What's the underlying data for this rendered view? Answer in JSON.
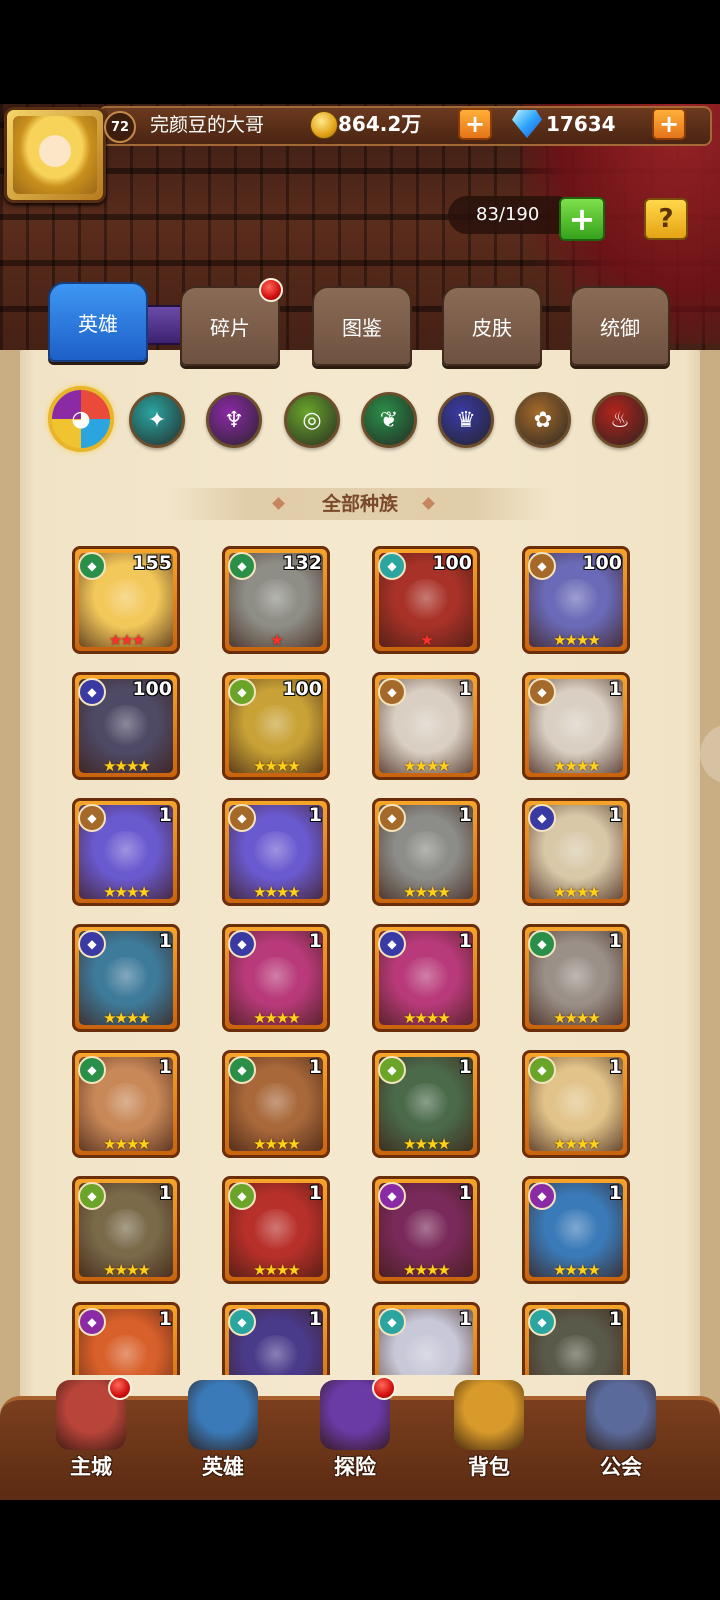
{
  "player": {
    "level": "72",
    "name": "完颜豆的大哥",
    "coins": "864.2万",
    "gems": "17634",
    "add_label": "+"
  },
  "capacity": {
    "text": "83/190",
    "add_label": "+",
    "help_label": "?"
  },
  "tabs": [
    {
      "label": "英雄",
      "active": true
    },
    {
      "label": "碎片",
      "active": false,
      "notification": true
    },
    {
      "label": "图鉴",
      "active": false
    },
    {
      "label": "皮肤",
      "active": false
    },
    {
      "label": "统御",
      "active": false
    }
  ],
  "races": [
    {
      "icon": "all-races-icon",
      "color": "#e94a3a",
      "selected": true
    },
    {
      "icon": "race-water-icon",
      "color": "#2aa5a0"
    },
    {
      "icon": "race-mystic-icon",
      "color": "#8a2aa5"
    },
    {
      "icon": "race-forest-icon",
      "color": "#6aa52a"
    },
    {
      "icon": "race-nature-icon",
      "color": "#2a8f48"
    },
    {
      "icon": "race-shadow-icon",
      "color": "#3a3aa5"
    },
    {
      "icon": "race-light-icon",
      "color": "#a56a2a"
    },
    {
      "icon": "race-fire-icon",
      "color": "#b2241c"
    }
  ],
  "race_filter_title": "全部种族",
  "heroes": [
    {
      "level": "155",
      "race_color": "#2a8f48",
      "stars": "★★★",
      "star_color": "#ff3030",
      "art": "#f3c85a"
    },
    {
      "level": "132",
      "race_color": "#2a8f48",
      "stars": "★",
      "star_color": "#ff3030",
      "art": "#8e8e86"
    },
    {
      "level": "100",
      "race_color": "#2aa5a0",
      "stars": "★",
      "star_color": "#ff3030",
      "art": "#a83228"
    },
    {
      "level": "100",
      "race_color": "#a56a2a",
      "stars": "★★★★",
      "star_color": "#ffd21a",
      "art": "#6a6ab8"
    },
    {
      "level": "100",
      "race_color": "#3a3aa5",
      "stars": "★★★★",
      "star_color": "#ffd21a",
      "art": "#4e4a66"
    },
    {
      "level": "100",
      "race_color": "#6aa52a",
      "stars": "★★★★",
      "star_color": "#ffd21a",
      "art": "#c8a236"
    },
    {
      "level": "1",
      "race_color": "#a56a2a",
      "stars": "★★★★",
      "star_color": "#ffd21a",
      "art": "#d9cfc2"
    },
    {
      "level": "1",
      "race_color": "#a56a2a",
      "stars": "★★★★",
      "star_color": "#ffd21a",
      "art": "#d9cfc2"
    },
    {
      "level": "1",
      "race_color": "#a56a2a",
      "stars": "★★★★",
      "star_color": "#ffd21a",
      "art": "#6a5ad0"
    },
    {
      "level": "1",
      "race_color": "#a56a2a",
      "stars": "★★★★",
      "star_color": "#ffd21a",
      "art": "#6a5ad0"
    },
    {
      "level": "1",
      "race_color": "#a56a2a",
      "stars": "★★★★",
      "star_color": "#ffd21a",
      "art": "#8c8c88"
    },
    {
      "level": "1",
      "race_color": "#3a3aa5",
      "stars": "★★★★",
      "star_color": "#ffd21a",
      "art": "#d8c8a8"
    },
    {
      "level": "1",
      "race_color": "#3a3aa5",
      "stars": "★★★★",
      "star_color": "#ffd21a",
      "art": "#3e7a9a"
    },
    {
      "level": "1",
      "race_color": "#3a3aa5",
      "stars": "★★★★",
      "star_color": "#ffd21a",
      "art": "#b83a7a"
    },
    {
      "level": "1",
      "race_color": "#3a3aa5",
      "stars": "★★★★",
      "star_color": "#ffd21a",
      "art": "#b83a7a"
    },
    {
      "level": "1",
      "race_color": "#2a8f48",
      "stars": "★★★★",
      "star_color": "#ffd21a",
      "art": "#9a9088"
    },
    {
      "level": "1",
      "race_color": "#2a8f48",
      "stars": "★★★★",
      "star_color": "#ffd21a",
      "art": "#c88858"
    },
    {
      "level": "1",
      "race_color": "#2a8f48",
      "stars": "★★★★",
      "star_color": "#ffd21a",
      "art": "#a8683a"
    },
    {
      "level": "1",
      "race_color": "#6aa52a",
      "stars": "★★★★",
      "star_color": "#ffd21a",
      "art": "#4a6a4a"
    },
    {
      "level": "1",
      "race_color": "#6aa52a",
      "stars": "★★★★",
      "star_color": "#ffd21a",
      "art": "#e2c48a"
    },
    {
      "level": "1",
      "race_color": "#6aa52a",
      "stars": "★★★★",
      "star_color": "#ffd21a",
      "art": "#7a6a4a"
    },
    {
      "level": "1",
      "race_color": "#6aa52a",
      "stars": "★★★★",
      "star_color": "#ffd21a",
      "art": "#b8302a"
    },
    {
      "level": "1",
      "race_color": "#8a2aa5",
      "stars": "★★★★",
      "star_color": "#ffd21a",
      "art": "#7a2a5a"
    },
    {
      "level": "1",
      "race_color": "#8a2aa5",
      "stars": "★★★★",
      "star_color": "#ffd21a",
      "art": "#3a7ab8"
    },
    {
      "level": "1",
      "race_color": "#8a2aa5",
      "stars": "",
      "star_color": "#ffd21a",
      "art": "#d8602a"
    },
    {
      "level": "1",
      "race_color": "#2aa5a0",
      "stars": "",
      "star_color": "#ffd21a",
      "art": "#4a3a8a"
    },
    {
      "level": "1",
      "race_color": "#2aa5a0",
      "stars": "",
      "star_color": "#ffd21a",
      "art": "#c8c8d8"
    },
    {
      "level": "1",
      "race_color": "#2aa5a0",
      "stars": "",
      "star_color": "#ffd21a",
      "art": "#5a5a4a"
    }
  ],
  "nav": [
    {
      "label": "主城",
      "icon": "castle-icon",
      "notification": true,
      "color": "#b8443a"
    },
    {
      "label": "英雄",
      "icon": "hero-portrait-icon",
      "notification": false,
      "color": "#3a7ab8"
    },
    {
      "label": "探险",
      "icon": "portal-icon",
      "notification": true,
      "color": "#6a3aa5"
    },
    {
      "label": "背包",
      "icon": "backpack-icon",
      "notification": false,
      "color": "#d89a2a"
    },
    {
      "label": "公会",
      "icon": "guild-tower-icon",
      "notification": false,
      "color": "#5a6a9a"
    }
  ]
}
